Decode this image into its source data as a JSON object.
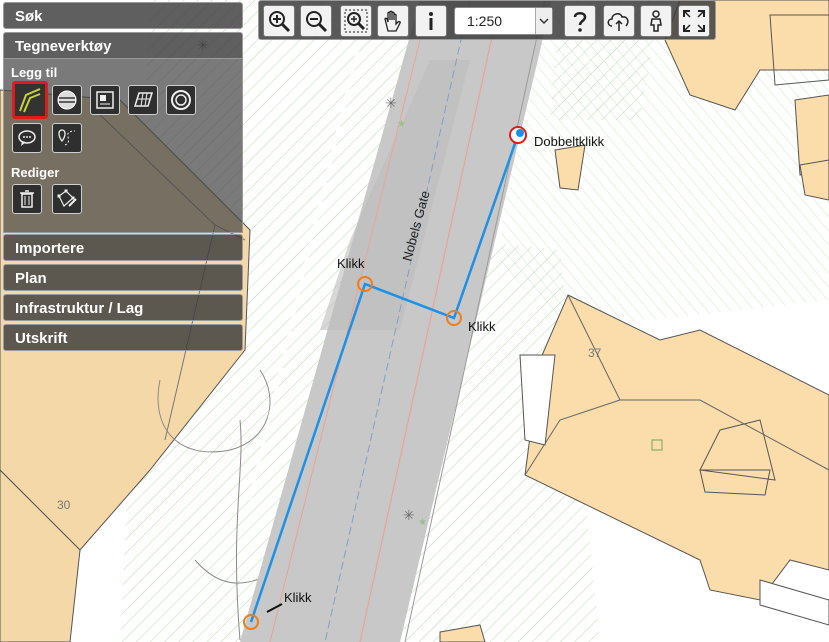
{
  "panel": {
    "search_label": "Søk",
    "draw_tools_label": "Tegneverktøy",
    "add_label": "Legg til",
    "edit_label": "Rediger",
    "import_label": "Importere",
    "plan_label": "Plan",
    "infrastructure_label": "Infrastruktur / Lag",
    "print_label": "Utskrift"
  },
  "toolbar": {
    "scale_value": "1:250",
    "icons": [
      "zoom-in-icon",
      "zoom-out-icon",
      "zoom-box-icon",
      "pan-hand-icon",
      "info-icon",
      "help-icon",
      "cloud-upload-icon",
      "person-icon",
      "fullscreen-icon"
    ]
  },
  "map": {
    "street_name": "Nobels Gate",
    "building_number_1": "37",
    "building_number_2": "30",
    "annotations": {
      "click_1": "Klikk",
      "click_2": "Klikk",
      "click_3": "Klikk",
      "double_click": "Dobbeltklikk"
    },
    "colors": {
      "drawn_line": "#1e90e6",
      "click_marker": "#f07d1a",
      "double_click_marker": "#e01b1b",
      "building_fill": "#fbdcab",
      "road_fill": "#c8c8c8"
    }
  }
}
